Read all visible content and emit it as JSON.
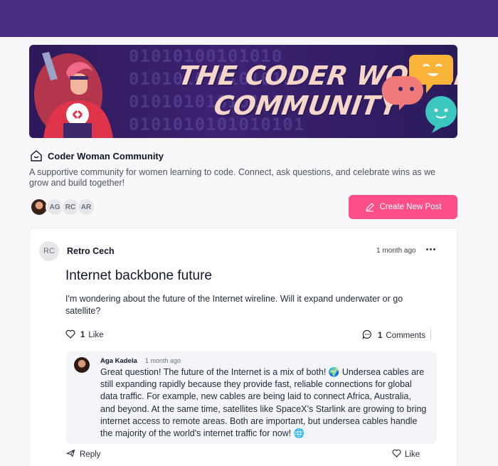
{
  "banner": {
    "title_line1": "THE CODER WOMAN",
    "title_line2": "COMMUNITY",
    "brand_color": "#4b2e83"
  },
  "community": {
    "name": "Coder Woman Community",
    "description": "A supportive community for women learning to code. Connect, ask questions, and celebrate wins as we grow and build together!",
    "members": [
      "AG",
      "RC",
      "AR"
    ]
  },
  "actions": {
    "create_post_label": "Create New Post",
    "accent_color": "#ff4f88"
  },
  "post": {
    "author_initials": "RC",
    "author": "Retro Cech",
    "time": "1 month ago",
    "title": "Internet backbone future",
    "body": "I'm wondering about the future of the Internet wireline. Will it expand underwater or go satellite?",
    "like_count": "1",
    "like_label": "Like",
    "comment_count": "1",
    "comment_label": "Comments"
  },
  "comment": {
    "author": "Aga Kadela",
    "time": "1 month ago",
    "text": "Great question! The future of the Internet is a mix of both! 🌍 Undersea cables are still expanding rapidly because they provide fast, reliable connections for global data traffic. For example, new cables are being laid to connect Africa, Australia, and beyond. At the same time, satellites like SpaceX’s Starlink are growing to bring internet access to remote areas. Both are important, but undersea cables handle the majority of the world's internet traffic for now! 🌐",
    "reply_label": "Reply",
    "like_label": "Like"
  }
}
